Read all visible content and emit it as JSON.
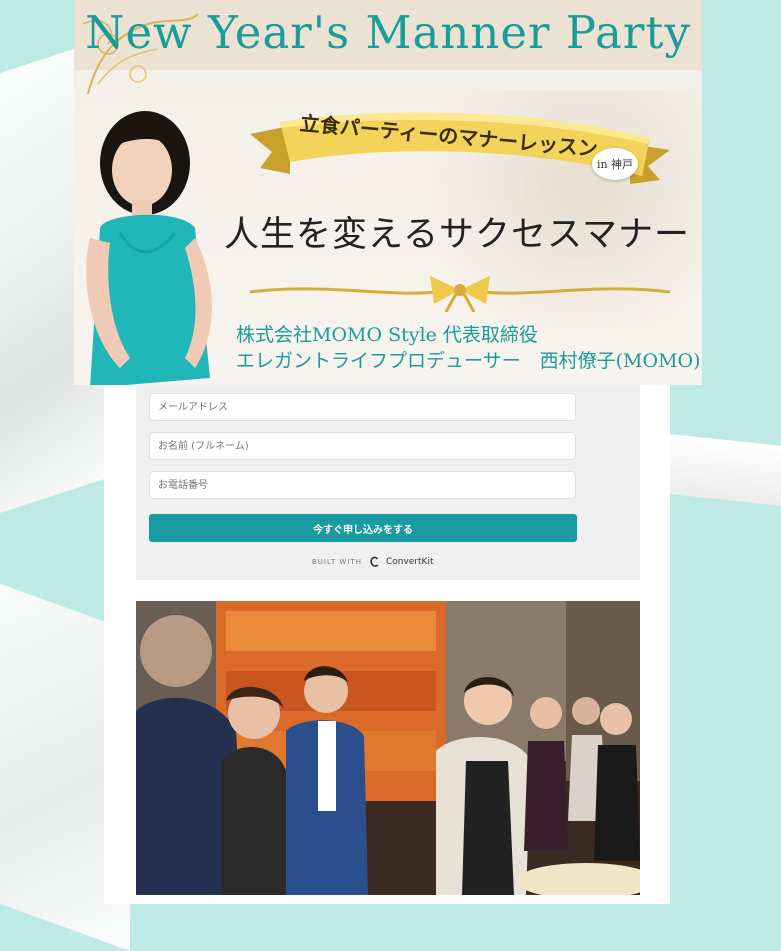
{
  "hero": {
    "title": "New Year's Manner Party",
    "banner": "立食パーティーのマナーレッスン",
    "location_badge": "in 神戸",
    "heading": "人生を変えるサクセスマナー",
    "company": "株式会社MOMO Style 代表取締役",
    "producer": "エレガントライフプロデューサー　西村僚子(MOMO)"
  },
  "form": {
    "email_placeholder": "メールアドレス",
    "name_placeholder": "お名前 (フルネーム)",
    "phone_placeholder": "お電話番号",
    "submit_label": "今すぐ申し込みをする",
    "built_with": "BUILT WITH",
    "provider": "ConvertKit"
  },
  "colors": {
    "accent": "#1a9aa3",
    "title_teal": "#1a9c9a",
    "background": "#bfe9e6"
  }
}
